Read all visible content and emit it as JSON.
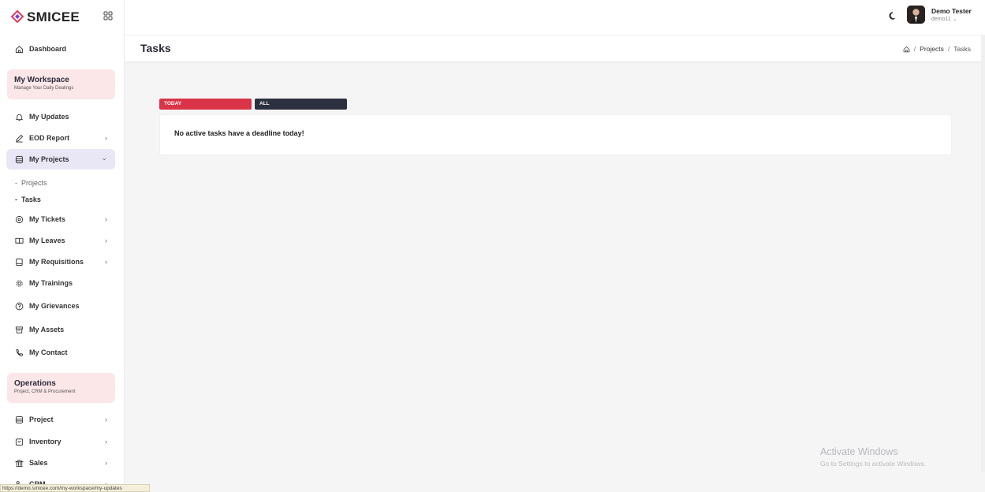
{
  "brand": {
    "name": "SMICEE"
  },
  "sidebar": {
    "items": [
      {
        "label": "Dashboard"
      },
      {
        "label": "My Updates"
      },
      {
        "label": "EOD Report"
      },
      {
        "label": "My Projects"
      },
      {
        "label": "My Tickets"
      },
      {
        "label": "My Leaves"
      },
      {
        "label": "My Requisitions"
      },
      {
        "label": "My Trainings"
      },
      {
        "label": "My Grievances"
      },
      {
        "label": "My Assets"
      },
      {
        "label": "My Contact"
      },
      {
        "label": "Project"
      },
      {
        "label": "Inventory"
      },
      {
        "label": "Sales"
      },
      {
        "label": "CRM"
      }
    ],
    "sub_items": [
      {
        "label": "Projects"
      },
      {
        "label": "Tasks"
      }
    ],
    "workspace": {
      "title": "My Workspace",
      "subtitle": "Manage Your Daily Dealings"
    },
    "operations": {
      "title": "Operations",
      "subtitle": "Project, CRM & Procurement"
    },
    "chevron_right": "›",
    "chevron_down": "⌄",
    "dash": "-"
  },
  "user": {
    "name": "Demo Tester",
    "id": "demo11 ⌄"
  },
  "page": {
    "title": "Tasks",
    "breadcrumb": [
      "Projects",
      "Tasks"
    ],
    "breadcrumb_sep": "/"
  },
  "tabs": {
    "today": "TODAY",
    "all": "ALL"
  },
  "content": {
    "empty_message": "No active tasks have a deadline today!"
  },
  "watermark": {
    "line1": "Activate Windows",
    "line2": "Go to Settings to activate Windows."
  },
  "status_url": "https://demo.smicee.com/my-workspace/my-updates",
  "colors": {
    "accent_red": "#d93447",
    "dark": "#2c3040",
    "active_bg": "#e9e6f5",
    "section_bg": "#fbe7e8"
  },
  "icons": [
    "grid-icon",
    "home-icon",
    "bell-icon",
    "pen-icon",
    "database-icon",
    "ticket-icon",
    "book-icon",
    "clipboard-icon",
    "gear-icon",
    "question-icon",
    "archive-icon",
    "phone-icon",
    "inventory-icon",
    "bank-icon",
    "people-icon",
    "moon-icon"
  ]
}
